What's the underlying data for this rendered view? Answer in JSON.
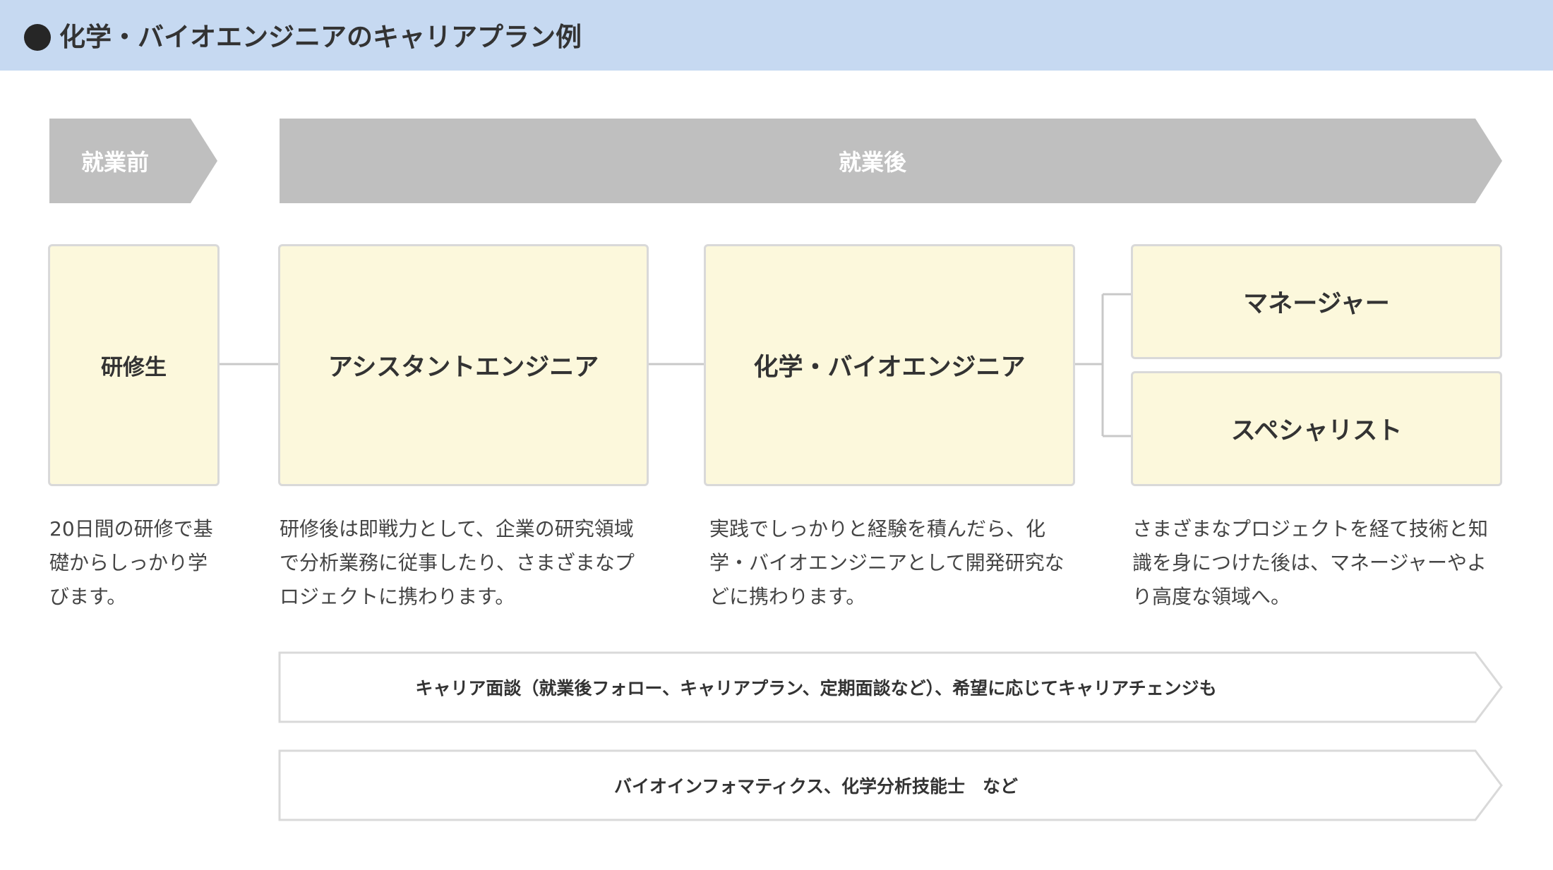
{
  "header": {
    "title": "化学・バイオエンジニアのキャリアプラン例"
  },
  "phases": {
    "before": "就業前",
    "after": "就業後"
  },
  "boxes": {
    "trainee": "研修生",
    "assistant": "アシスタントエンジニア",
    "engineer": "化学・バイオエンジニア",
    "manager": "マネージャー",
    "specialist": "スペシャリスト"
  },
  "descriptions": {
    "trainee": [
      "20日間の研修で基",
      "礎からしっかり学",
      "びます。"
    ],
    "assistant": [
      "研修後は即戦力として、企業の研究領域",
      "で分析業務に従事したり、さまざまなプ",
      "ロジェクトに携わります。"
    ],
    "engineer": [
      "実践でしっかりと経験を積んだら、化",
      "学・バイオエンジニアとして開発研究な",
      "どに携わります。"
    ],
    "career": [
      "さまざまなプロジェクトを経て技術と知",
      "識を身につけた後は、マネージャーやよ",
      "り高度な領域へ。"
    ]
  },
  "support": {
    "interview": "キャリア面談（就業後フォロー、キャリアプラン、定期面談など）、希望に応じてキャリアチェンジも",
    "skills": "バイオインフォマティクス、化学分析技能士　など"
  },
  "colors": {
    "header_bg": "#c6d9f1",
    "phase_arrow": "#bfbfbf",
    "box_fill": "#fcf8dc",
    "box_border": "#d9d9d9",
    "connector": "#c8c8c8"
  }
}
